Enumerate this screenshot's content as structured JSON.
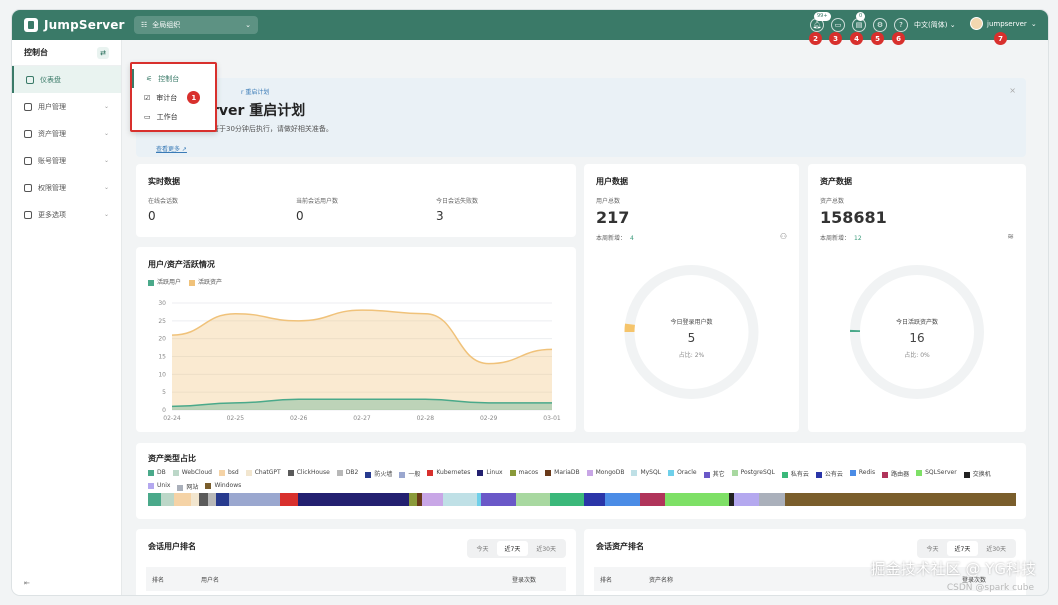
{
  "app": {
    "name": "JumpServer",
    "org": "全局组织"
  },
  "topbar": {
    "msg_count": "99+",
    "ticket_count": "0",
    "language": "中文(简体)",
    "username": "jumpserver",
    "badges": [
      "2",
      "3",
      "4",
      "5",
      "6",
      "7"
    ]
  },
  "sidebar": {
    "title": "控制台",
    "items": [
      {
        "label": "仪表盘",
        "icon": "dashboard-icon"
      },
      {
        "label": "用户管理",
        "icon": "user-icon"
      },
      {
        "label": "资产管理",
        "icon": "asset-icon"
      },
      {
        "label": "账号管理",
        "icon": "account-icon"
      },
      {
        "label": "权限管理",
        "icon": "permission-icon"
      },
      {
        "label": "更多选项",
        "icon": "more-icon"
      }
    ],
    "footer": "⇤"
  },
  "view_menu": {
    "items": [
      {
        "label": "控制台",
        "icon": "console-icon"
      },
      {
        "label": "审计台",
        "icon": "audit-icon"
      },
      {
        "label": "工作台",
        "icon": "workbench-icon"
      }
    ],
    "badge": "1"
  },
  "banner": {
    "tag": "r 重启计划",
    "title": "rver 重启计划",
    "subtitle": "本次后重启计划，将于30分钟后执行，请做好相关准备。",
    "link": "查看更多"
  },
  "realtime": {
    "title": "实时数据",
    "metrics": [
      {
        "label": "在线会话数",
        "value": "0"
      },
      {
        "label": "当前会话用户数",
        "value": "0"
      },
      {
        "label": "今日会话失败数",
        "value": "3"
      }
    ]
  },
  "users": {
    "title": "用户数据",
    "total_label": "用户总数",
    "total": "217",
    "week_label": "本周新增：",
    "week_value": "4",
    "donut_title": "今日登录用户数",
    "donut_value": "5",
    "donut_ratio": "占比: 2%",
    "ratio_pct": 2,
    "color": "#f5c46b"
  },
  "assets": {
    "title": "资产数据",
    "total_label": "资产总数",
    "total": "158681",
    "week_label": "本周新增：",
    "week_value": "12",
    "donut_title": "今日活跃资产数",
    "donut_value": "16",
    "donut_ratio": "占比: 0%",
    "ratio_pct": 0,
    "color": "#4aa98a"
  },
  "activity_chart_title": "用户/资产活跃情况",
  "chart_data": {
    "type": "area",
    "title": "用户/资产活跃情况",
    "x": [
      "02-24",
      "02-25",
      "02-26",
      "02-27",
      "02-28",
      "02-29",
      "03-01"
    ],
    "ylim": [
      0,
      30
    ],
    "yticks": [
      0,
      5,
      10,
      15,
      20,
      25,
      30
    ],
    "series": [
      {
        "name": "活跃用户",
        "color": "#4aa98a",
        "values": [
          1,
          2,
          3,
          3,
          3,
          2,
          2
        ]
      },
      {
        "name": "活跃资产",
        "color": "#f0c27a",
        "values": [
          21,
          27,
          25,
          28,
          27,
          13,
          17
        ]
      }
    ]
  },
  "asset_types": {
    "title": "资产类型占比",
    "items": [
      {
        "label": "DB",
        "color": "#4aa98a",
        "share": 1.5
      },
      {
        "label": "WebCloud",
        "color": "#bcd7c8",
        "share": 1.5
      },
      {
        "label": "bsd",
        "color": "#f5d3a6",
        "share": 2
      },
      {
        "label": "ChatGPT",
        "color": "#f2e6cf",
        "share": 1
      },
      {
        "label": "ClickHouse",
        "color": "#5a5a5a",
        "share": 1
      },
      {
        "label": "DB2",
        "color": "#b8b8b8",
        "share": 1
      },
      {
        "label": "防火墙",
        "color": "#283b8f",
        "share": 1.5
      },
      {
        "label": "一般",
        "color": "#9aa7cf",
        "share": 6
      },
      {
        "label": "Kubernetes",
        "color": "#d8302d",
        "share": 2
      },
      {
        "label": "Linux",
        "color": "#232070",
        "share": 13
      },
      {
        "label": "macos",
        "color": "#8a9a3a",
        "share": 1
      },
      {
        "label": "MariaDB",
        "color": "#6a3a1a",
        "share": 0.5
      },
      {
        "label": "MongoDB",
        "color": "#c8a6e6",
        "share": 2.5
      },
      {
        "label": "MySQL",
        "color": "#bfe0e6",
        "share": 4
      },
      {
        "label": "Oracle",
        "color": "#6fd0ea",
        "share": 0.5
      },
      {
        "label": "其它",
        "color": "#6a58c8",
        "share": 4
      },
      {
        "label": "PostgreSQL",
        "color": "#a8d8a0",
        "share": 4
      },
      {
        "label": "私有云",
        "color": "#3bb87a",
        "share": 4
      },
      {
        "label": "公有云",
        "color": "#2a35a8",
        "share": 2.5
      },
      {
        "label": "Redis",
        "color": "#4b8ce6",
        "share": 4
      },
      {
        "label": "路由器",
        "color": "#b0345a",
        "share": 3
      },
      {
        "label": "SQLServer",
        "color": "#7ee066",
        "share": 7.5
      },
      {
        "label": "交换机",
        "color": "#222222",
        "share": 0.5
      },
      {
        "label": "Unix",
        "color": "#b4a8ef",
        "share": 3
      },
      {
        "label": "网站",
        "color": "#aab0bb",
        "share": 3
      },
      {
        "label": "Windows",
        "color": "#7a5e2c",
        "share": 27
      }
    ]
  },
  "session_users": {
    "title": "会话用户排名",
    "tabs": [
      "今天",
      "近7天",
      "近30天"
    ],
    "active_tab": 1,
    "columns": [
      "排名",
      "用户名",
      "登录次数"
    ]
  },
  "session_assets": {
    "title": "会话资产排名",
    "tabs": [
      "今天",
      "近7天",
      "近30天"
    ],
    "active_tab": 1,
    "columns": [
      "排名",
      "资产名称",
      "登录次数"
    ]
  },
  "watermark": {
    "main": "掘金技术社区 @ YG科技",
    "sub": "CSDN @spark cube"
  }
}
